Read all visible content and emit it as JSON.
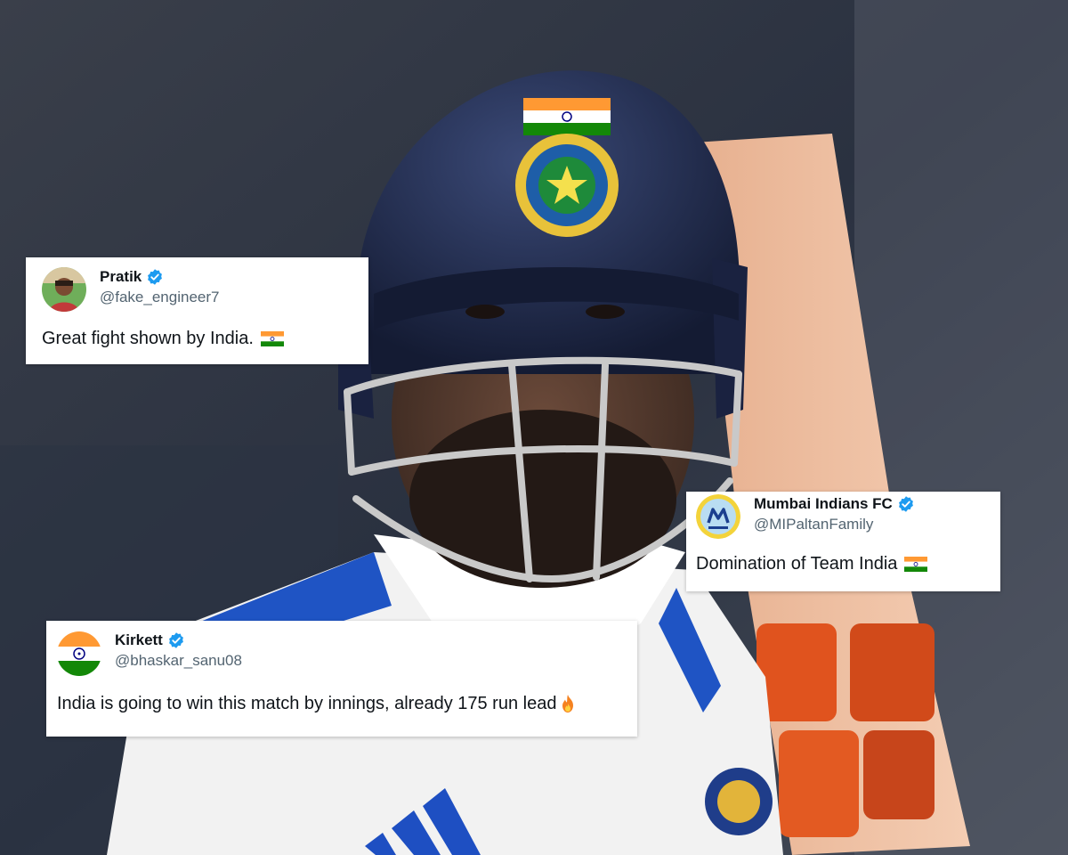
{
  "colors": {
    "verified_blue": "#1d9bf0",
    "name_text": "#0f1419",
    "handle_text": "#536471",
    "helmet_navy": "#1f2a4a",
    "saffron": "#ff9933",
    "india_green": "#138808"
  },
  "tweets": [
    {
      "name": "Pratik",
      "handle": "@fake_engineer7",
      "text": "Great fight shown by India.",
      "trailing_icon": "india-flag-icon",
      "avatar_icon": "person-photo-avatar",
      "verified": true
    },
    {
      "name": "Mumbai Indians FC",
      "handle": "@MIPaltanFamily",
      "text": "Domination of Team India",
      "trailing_icon": "india-flag-icon",
      "avatar_icon": "mi-logo-avatar",
      "verified": true
    },
    {
      "name": "Kirkett",
      "handle": "@bhaskar_sanu08",
      "text": "India is going to win this match by innings, already 175 run lead",
      "trailing_icon": "fire-icon",
      "avatar_icon": "india-flag-avatar",
      "verified": true
    }
  ]
}
